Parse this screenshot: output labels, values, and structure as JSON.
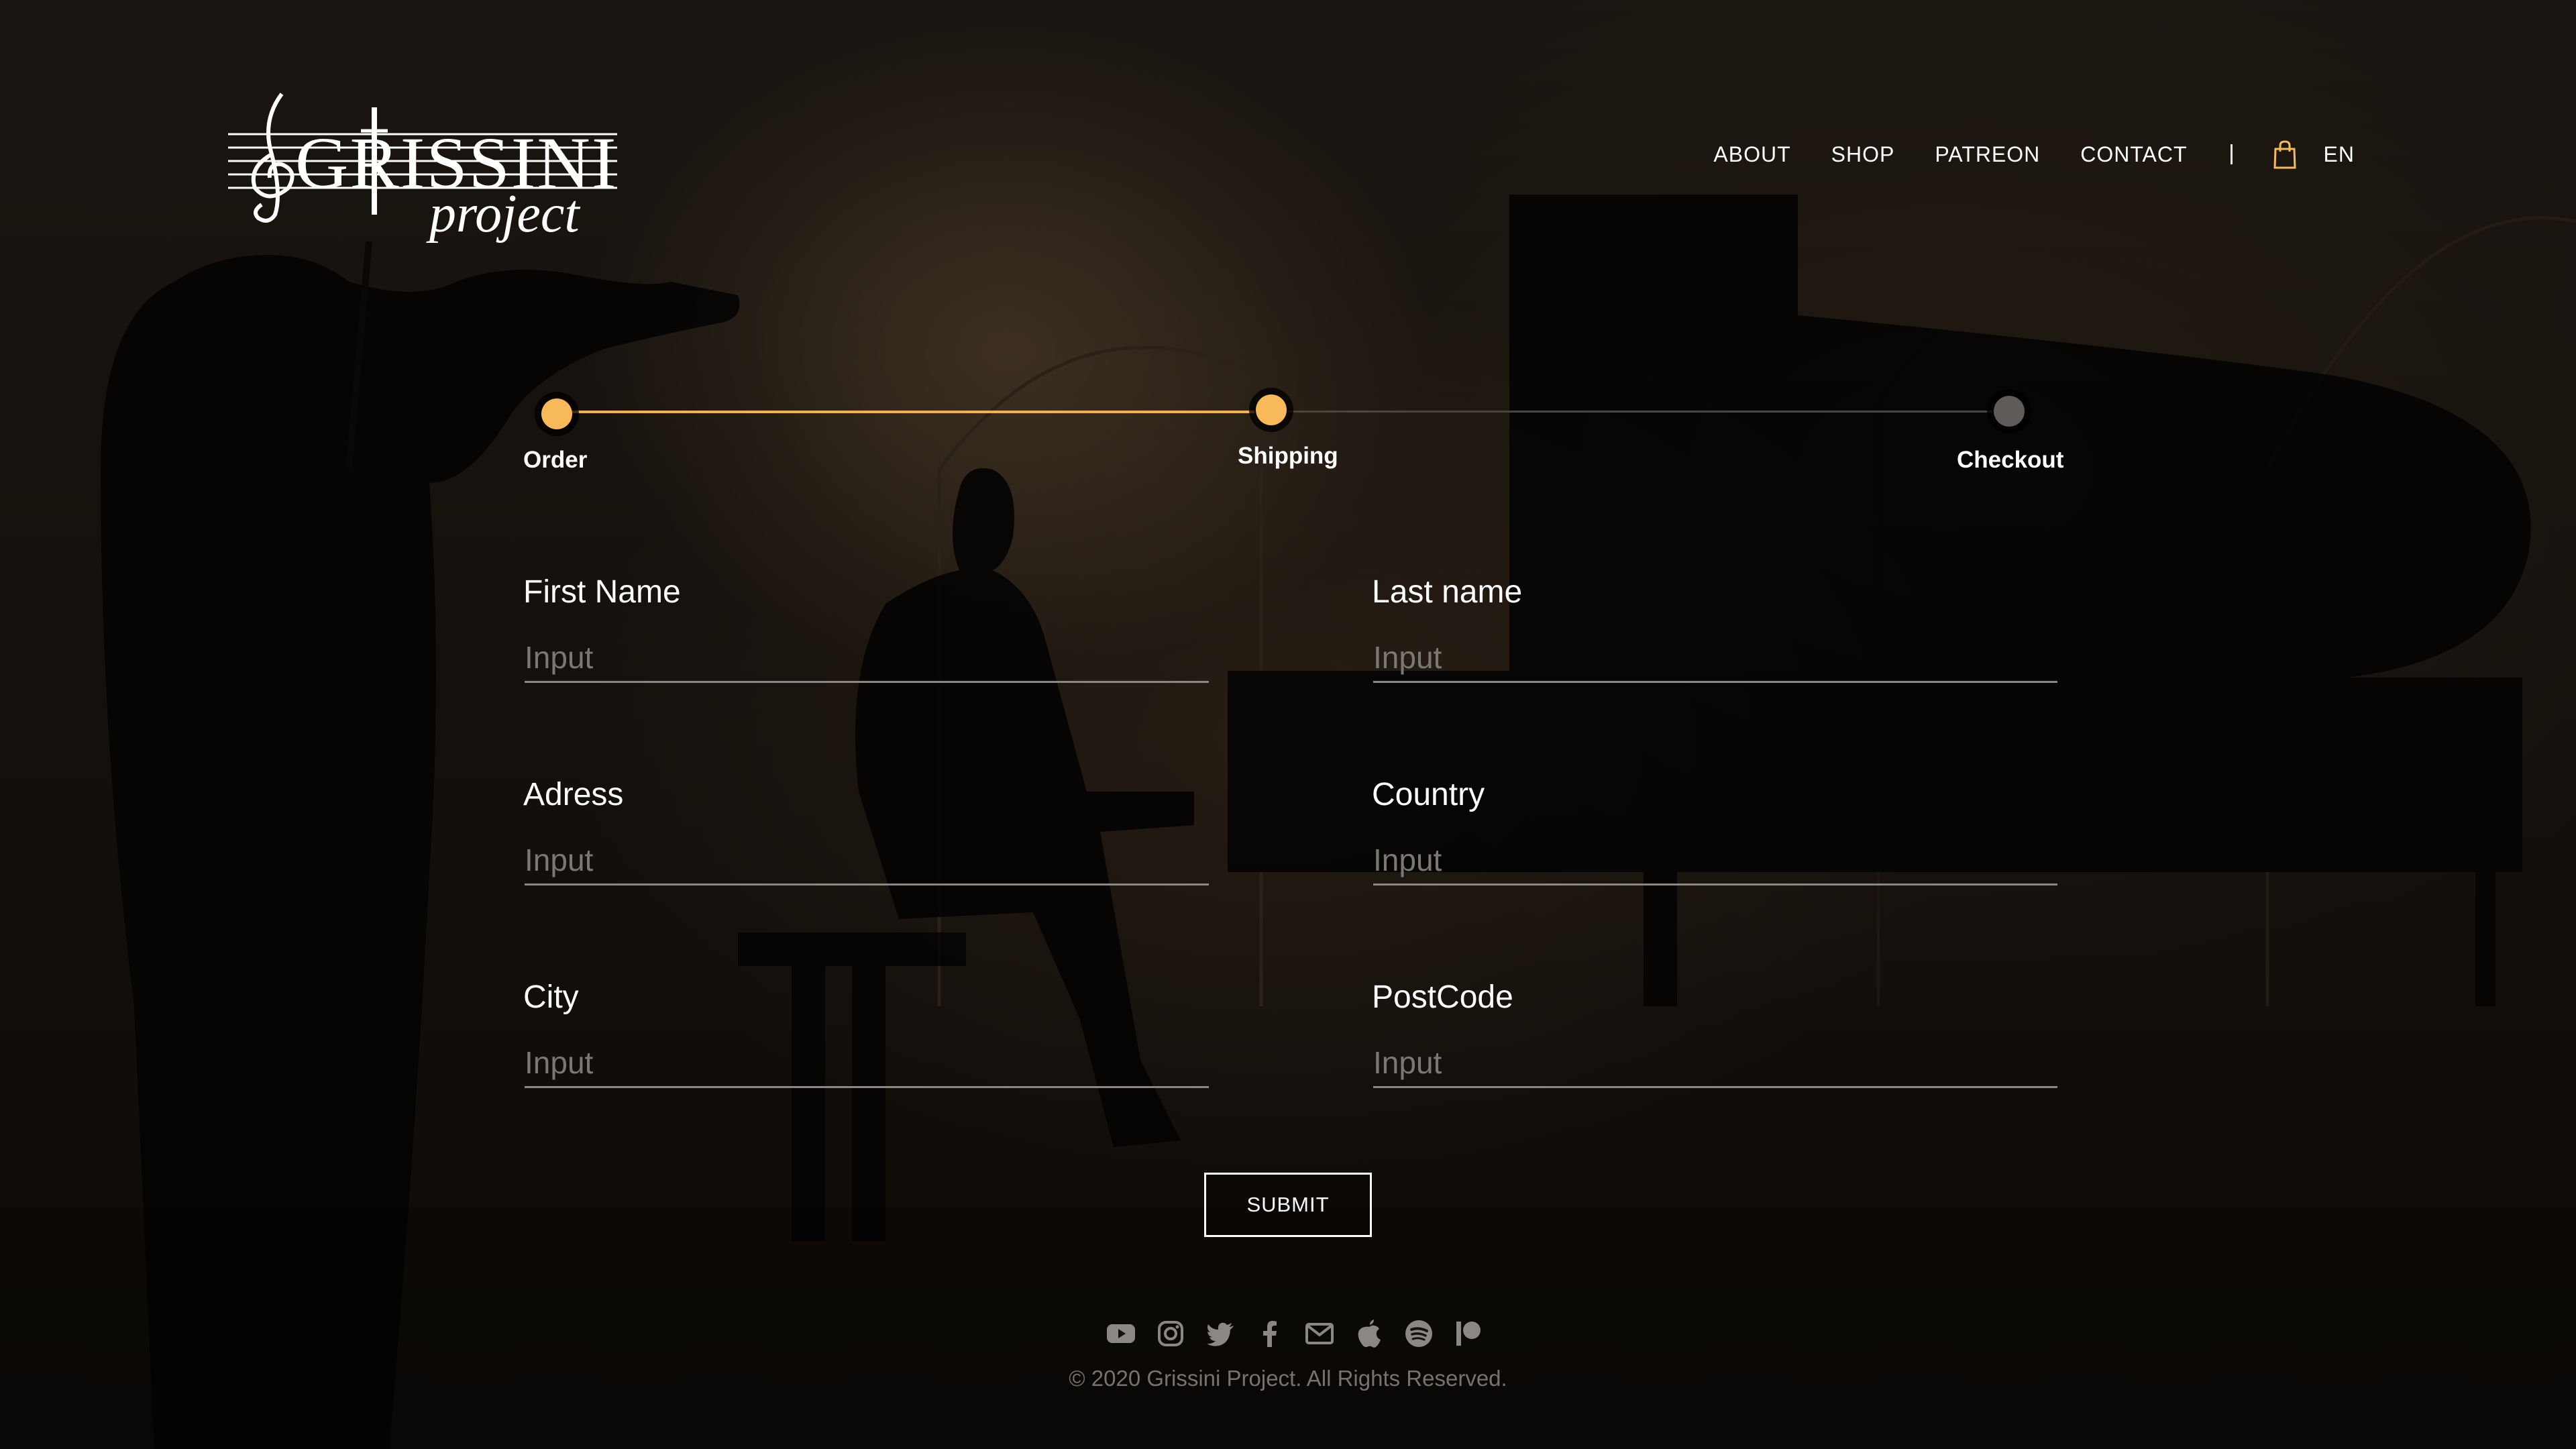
{
  "brand": {
    "logo_text": "GRISSINI",
    "logo_subtext": "project"
  },
  "nav": {
    "items": [
      {
        "label": "ABOUT"
      },
      {
        "label": "SHOP"
      },
      {
        "label": "PATREON"
      },
      {
        "label": "CONTACT"
      }
    ],
    "language": "EN",
    "cart_icon": "shopping-bag-icon"
  },
  "stepper": {
    "steps": [
      {
        "label": "Order",
        "state": "complete"
      },
      {
        "label": "Shipping",
        "state": "current"
      },
      {
        "label": "Checkout",
        "state": "pending"
      }
    ]
  },
  "form": {
    "fields": [
      {
        "label": "First Name",
        "placeholder": "Input",
        "value": ""
      },
      {
        "label": "Last name",
        "placeholder": "Input",
        "value": ""
      },
      {
        "label": "Adress",
        "placeholder": "Input",
        "value": ""
      },
      {
        "label": "Country",
        "placeholder": "Input",
        "value": ""
      },
      {
        "label": "City",
        "placeholder": "Input",
        "value": ""
      },
      {
        "label": "PostCode",
        "placeholder": "Input",
        "value": ""
      }
    ],
    "submit_label": "SUBMIT"
  },
  "footer": {
    "social_icons": [
      "youtube-icon",
      "instagram-icon",
      "twitter-icon",
      "facebook-icon",
      "mail-icon",
      "apple-icon",
      "spotify-icon",
      "patreon-icon"
    ],
    "copyright": "© 2020 Grissini Project. All Rights Reserved."
  },
  "colors": {
    "accent": "#f7b95a",
    "progress_line": "#f2b04f",
    "inactive_step": "#5e5b58",
    "text": "#ffffff",
    "muted_text": "#77726d",
    "input_underline": "#8a8784"
  }
}
